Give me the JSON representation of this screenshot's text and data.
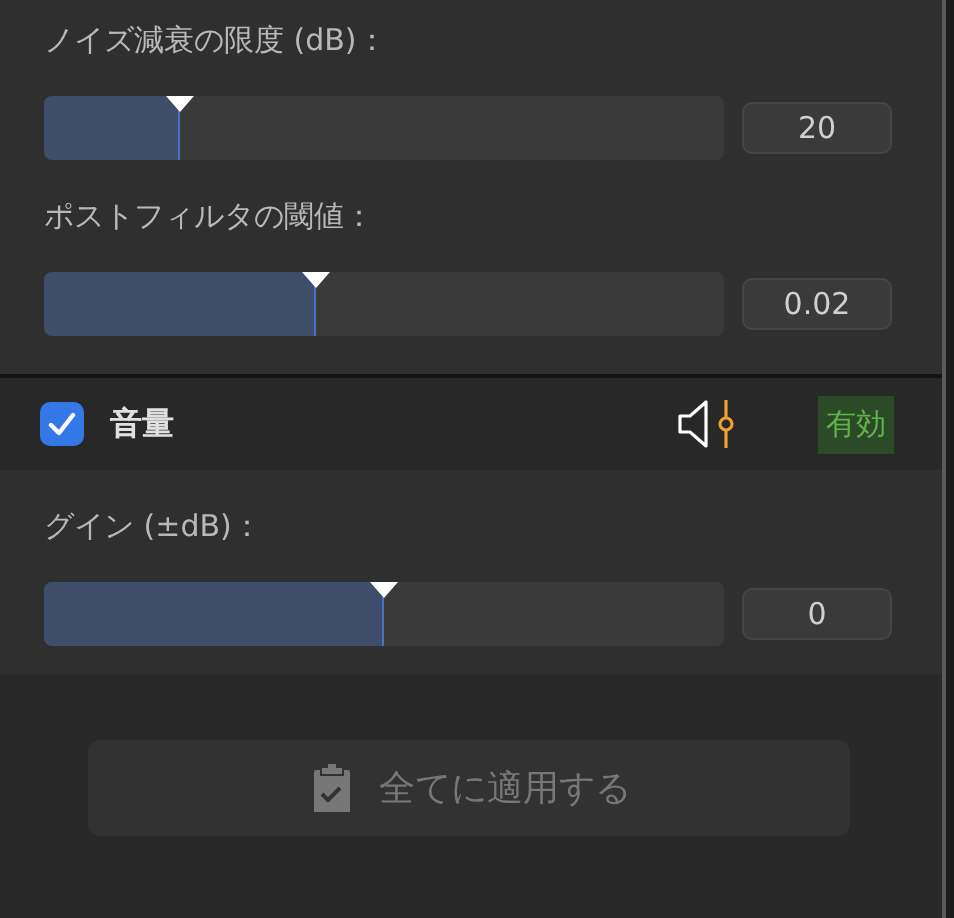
{
  "noise_reduction": {
    "sliders": [
      {
        "label": "ノイズ減衰の限度 (dB)：",
        "level": 0.2,
        "value": "20"
      },
      {
        "label": "ポストフィルタの閾値：",
        "level": 0.4,
        "value": "0.02"
      }
    ]
  },
  "volume": {
    "checked": true,
    "title": "音量",
    "status": "有効",
    "sliders": [
      {
        "label": "グイン (±dB)：",
        "level": 0.5,
        "value": "0"
      }
    ]
  },
  "apply_button": {
    "label": "全てに適用する",
    "disabled": true
  }
}
